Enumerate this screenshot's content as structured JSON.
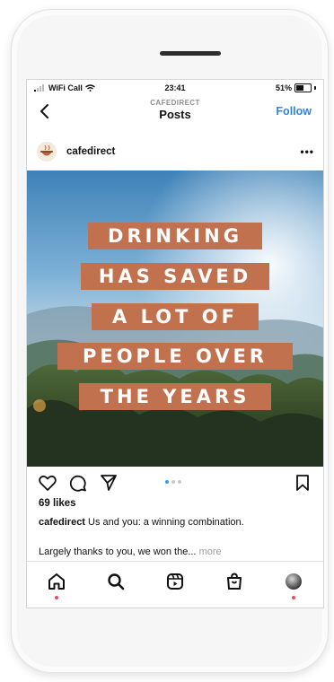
{
  "status_bar": {
    "carrier": "WiFi Call",
    "time": "23:41",
    "battery": "51%"
  },
  "header": {
    "subtitle": "CAFEDIRECT",
    "title": "Posts",
    "follow_label": "Follow"
  },
  "post": {
    "username": "cafedirect",
    "more_label": "•••",
    "image_text_lines": [
      "DRINKING",
      "HAS SAVED",
      "A LOT OF",
      "PEOPLE OVER",
      "THE YEARS"
    ],
    "likes": "69 likes",
    "caption_user": "cafedirect",
    "caption_text": "Us and you: a winning combination.",
    "caption_line2": "Largely thanks to you, we won the...",
    "more_link": "more",
    "carousel_pages": 3,
    "carousel_active": 1
  },
  "icons": {
    "back": "back-chevron-icon",
    "like": "heart-icon",
    "comment": "comment-icon",
    "share": "send-icon",
    "save": "bookmark-icon",
    "nav": [
      "home-icon",
      "search-icon",
      "reels-icon",
      "shop-icon",
      "profile-avatar"
    ]
  },
  "colors": {
    "accent": "#2f84e8",
    "banner": "#c2714f",
    "notification": "#ed4956"
  }
}
